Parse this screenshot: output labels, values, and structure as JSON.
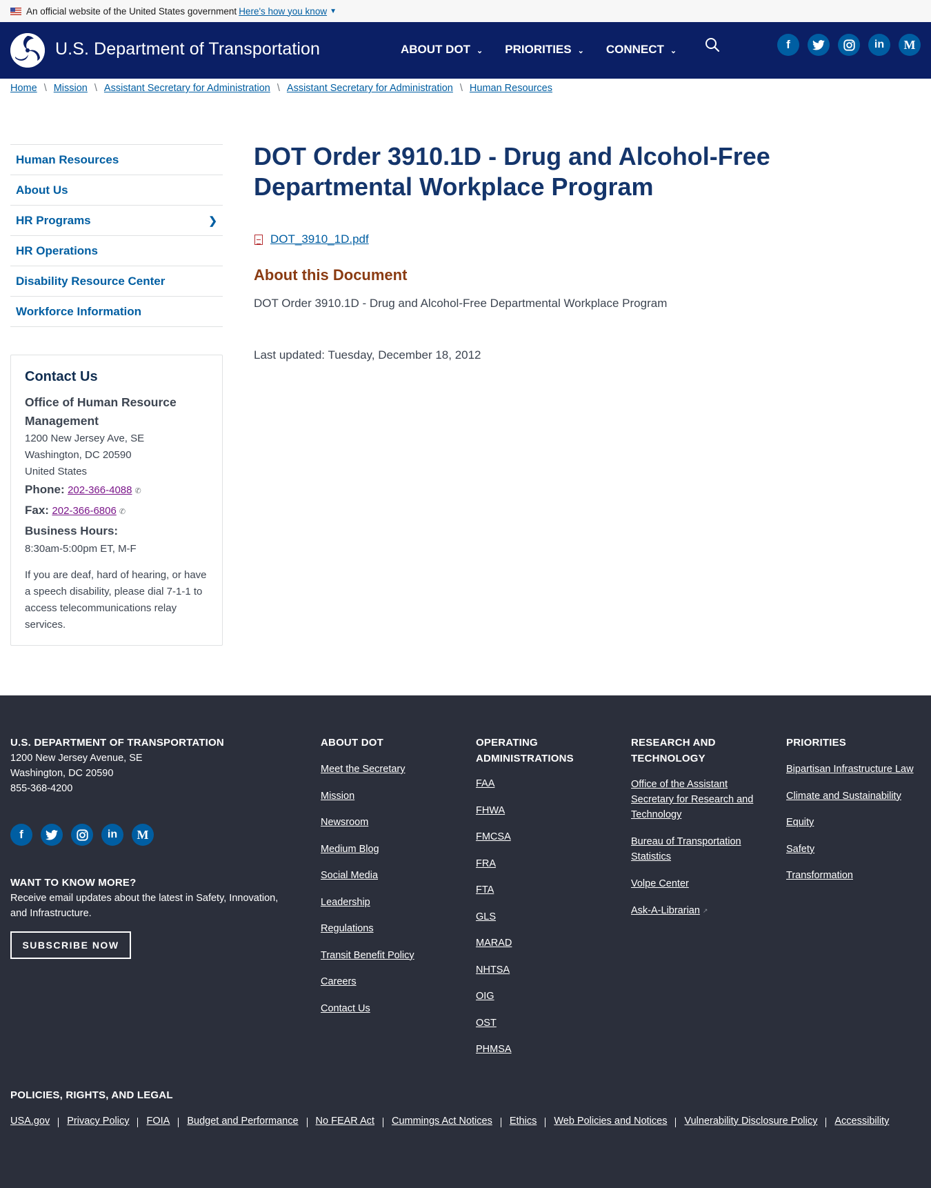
{
  "gov_banner": {
    "text": "An official website of the United States government",
    "link": "Here's how you know"
  },
  "header": {
    "title": "U.S. Department of Transportation",
    "nav": [
      "ABOUT DOT",
      "PRIORITIES",
      "CONNECT"
    ],
    "social": [
      "facebook-icon",
      "twitter-icon",
      "instagram-icon",
      "linkedin-icon",
      "medium-icon"
    ]
  },
  "breadcrumb": [
    "Home",
    "Mission",
    "Assistant Secretary for Administration",
    "Assistant Secretary for Administration",
    "Human Resources"
  ],
  "sidenav": [
    "Human Resources",
    "About Us",
    "HR Programs",
    "HR Operations",
    "Disability Resource Center",
    "Workforce Information"
  ],
  "contact": {
    "title": "Contact Us",
    "org": "Office of Human Resource Management",
    "address1": "1200 New Jersey Ave, SE",
    "address2": "Washington, DC 20590",
    "address3": "United States",
    "phone_label": "Phone:",
    "phone": "202-366-4088",
    "fax_label": "Fax:",
    "fax": "202-366-6806",
    "hours_label": "Business Hours:",
    "hours": "8:30am-5:00pm ET, M-F",
    "note": "If you are deaf, hard of hearing, or have a speech disability, please dial 7-1-1 to access telecommunications relay services."
  },
  "main": {
    "title": "DOT Order 3910.1D - Drug and Alcohol-Free Departmental Workplace Program",
    "file": "DOT_3910_1D.pdf",
    "about_heading": "About this Document",
    "about_text": "DOT Order 3910.1D - Drug and Alcohol-Free Departmental Workplace Program",
    "updated": "Last updated: Tuesday, December 18, 2012"
  },
  "footer": {
    "org": "U.S. DEPARTMENT OF TRANSPORTATION",
    "addr1": "1200 New Jersey Avenue, SE",
    "addr2": "Washington, DC 20590",
    "phone": "855-368-4200",
    "want_heading": "WANT TO KNOW MORE?",
    "want_text": "Receive email updates about the latest in Safety, Innovation, and Infrastructure.",
    "subscribe": "SUBSCRIBE NOW",
    "about_heading": "ABOUT DOT",
    "about_links": [
      "Meet the Secretary",
      "Mission",
      "Newsroom",
      "Medium Blog",
      "Social Media",
      "Leadership",
      "Regulations",
      "Transit Benefit Policy",
      "Careers",
      "Contact Us"
    ],
    "ops_heading": "OPERATING ADMINISTRATIONS",
    "ops_links": [
      "FAA",
      "FHWA",
      "FMCSA",
      "FRA",
      "FTA",
      "GLS",
      "MARAD",
      "NHTSA",
      "OIG",
      "OST",
      "PHMSA"
    ],
    "research_heading": "RESEARCH AND TECHNOLOGY",
    "research_links": [
      "Office of the Assistant Secretary for Research and Technology",
      "Bureau of Transportation Statistics",
      "Volpe Center",
      "Ask-A-Librarian"
    ],
    "priorities_heading": "PRIORITIES",
    "priorities_links": [
      "Bipartisan Infrastructure Law",
      "Climate and Sustainability",
      "Equity",
      "Safety",
      "Transformation"
    ],
    "policies_heading": "POLICIES, RIGHTS, AND LEGAL",
    "legal_links": [
      "USA.gov",
      "Privacy Policy",
      "FOIA",
      "Budget and Performance",
      "No FEAR Act",
      "Cummings Act Notices",
      "Ethics",
      "Web Policies and Notices",
      "Vulnerability Disclosure Policy",
      "Accessibility"
    ]
  }
}
